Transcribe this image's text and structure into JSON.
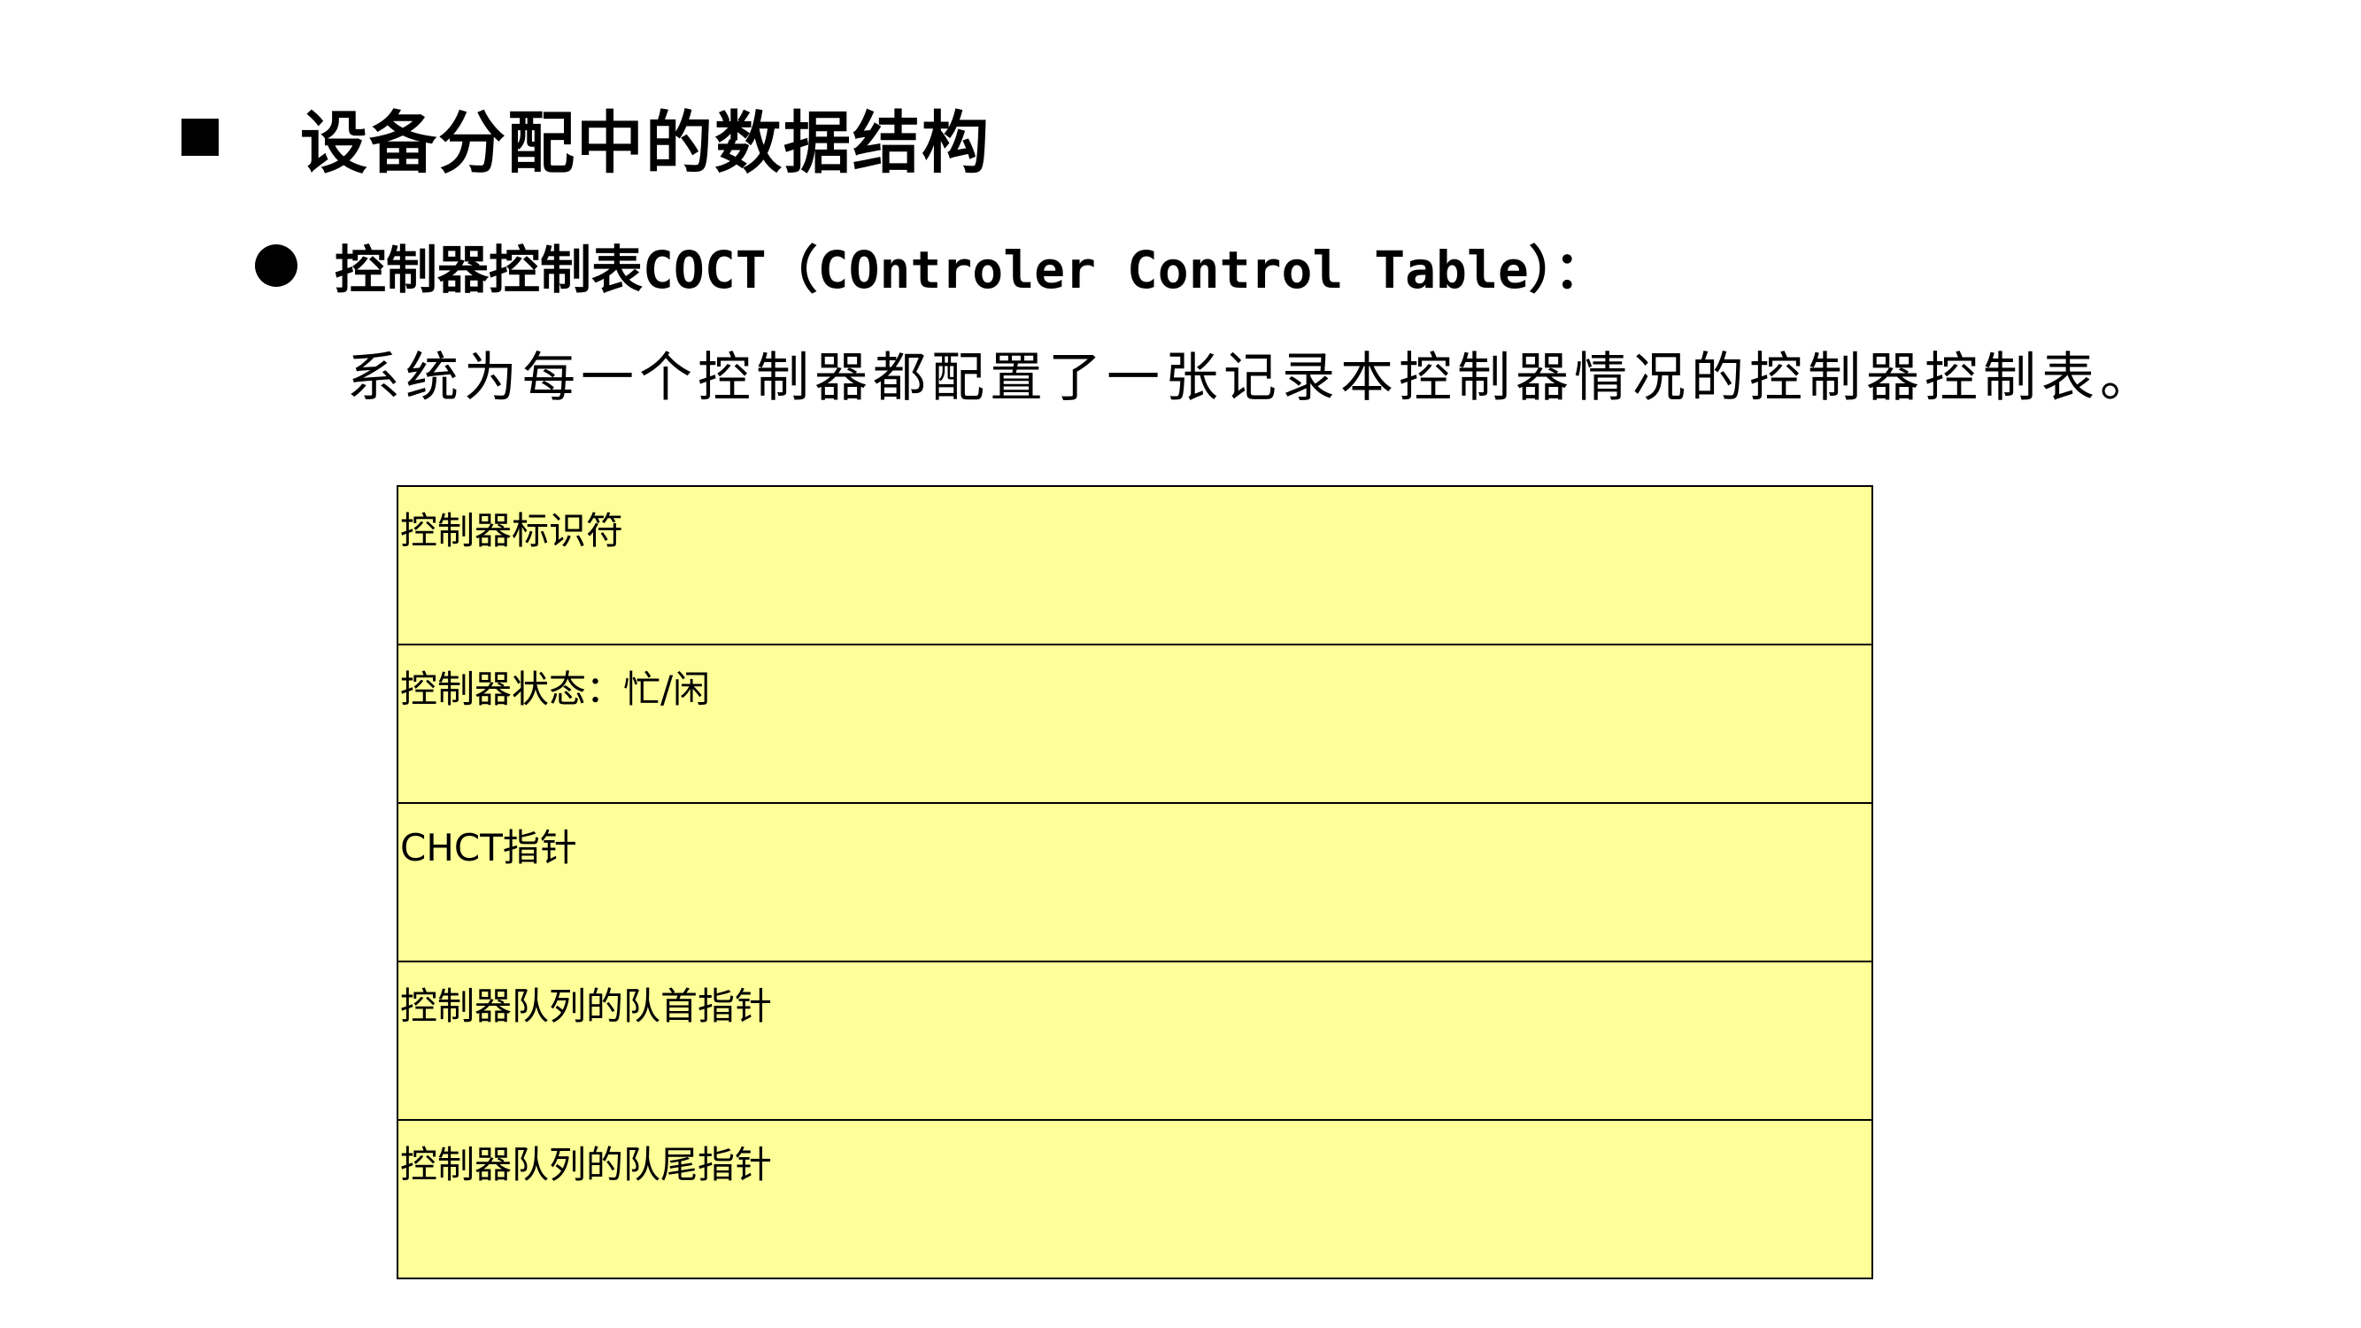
{
  "heading": "设备分配中的数据结构",
  "subheading": "控制器控制表COCT（COntroler Control Table）：",
  "description": "系统为每一个控制器都配置了一张记录本控制器情况的控制器控制表。",
  "table": {
    "fields": [
      "控制器标识符",
      "控制器状态：忙/闲",
      "CHCT指针",
      "控制器队列的队首指针",
      "控制器队列的队尾指针"
    ]
  },
  "colors": {
    "cell_fill": "#ffff99",
    "border": "#000000",
    "text": "#000000"
  }
}
